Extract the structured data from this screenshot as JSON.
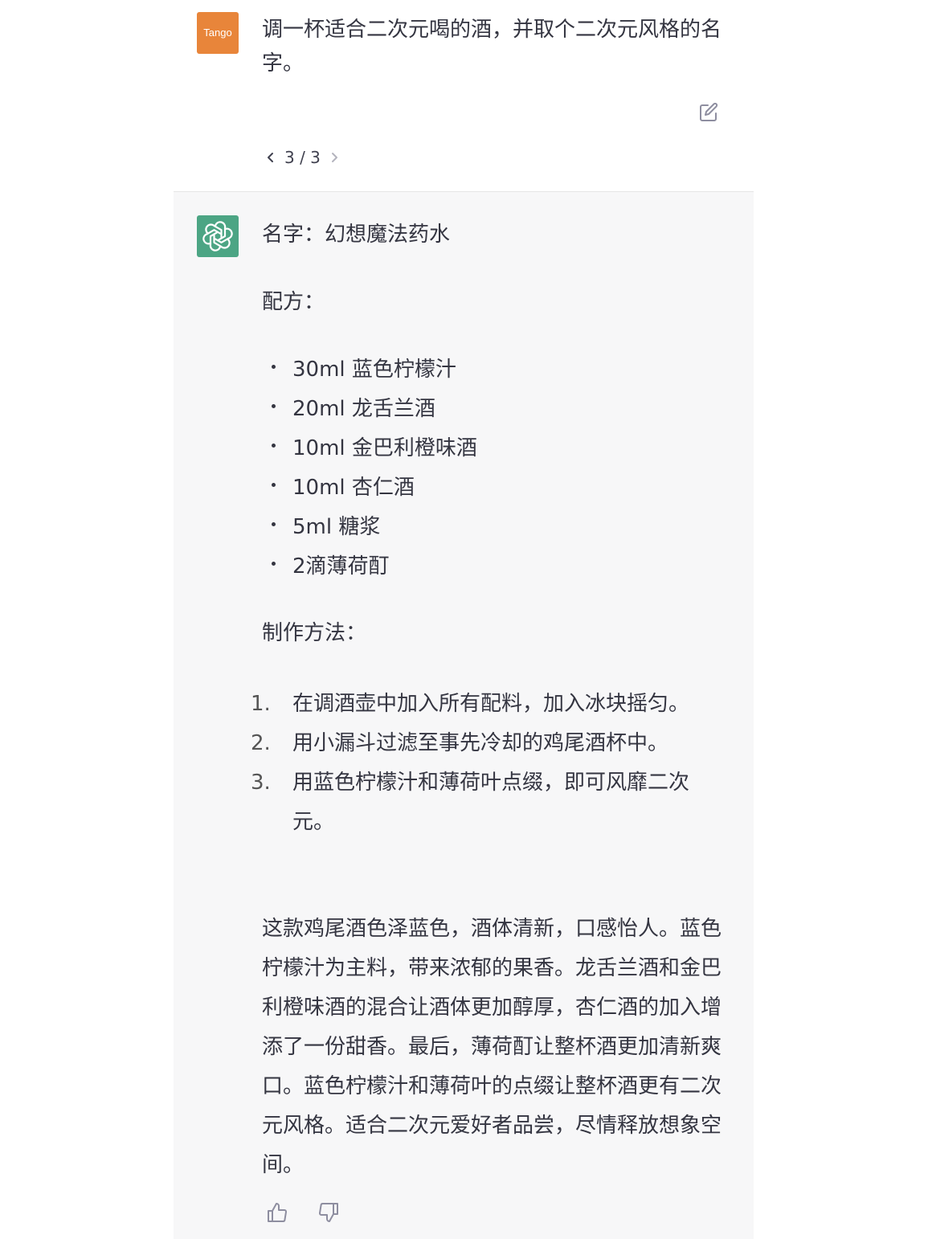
{
  "user_message": {
    "avatar_label": "Tango",
    "text": "调一杯适合二次元喝的酒，并取个二次元风格的名字。",
    "pager": "3 / 3"
  },
  "assistant_message": {
    "title_line": "名字：幻想魔法药水",
    "formula_label": "配方：",
    "ingredients": [
      "30ml 蓝色柠檬汁",
      "20ml 龙舌兰酒",
      "10ml 金巴利橙味酒",
      "10ml 杏仁酒",
      "5ml 糖浆",
      "2滴薄荷酊"
    ],
    "method_label": "制作方法：",
    "steps": [
      {
        "num": "1.",
        "text": "在调酒壶中加入所有配料，加入冰块摇匀。"
      },
      {
        "num": "2.",
        "text": "用小漏斗过滤至事先冷却的鸡尾酒杯中。"
      },
      {
        "num": "3.",
        "text": "用蓝色柠檬汁和薄荷叶点缀，即可风靡二次元。"
      }
    ],
    "description": "这款鸡尾酒色泽蓝色，酒体清新，口感怡人。蓝色柠檬汁为主料，带来浓郁的果香。龙舌兰酒和金巴利橙味酒的混合让酒体更加醇厚，杏仁酒的加入增添了一份甜香。最后，薄荷酊让整杯酒更加清新爽口。蓝色柠檬汁和薄荷叶的点缀让整杯酒更有二次元风格。适合二次元爱好者品尝，尽情释放想象空间。"
  },
  "icons": {
    "edit": "edit-icon",
    "prev": "chevron-left-icon",
    "next": "chevron-right-icon",
    "bot_avatar": "openai-logo-icon",
    "like": "thumbs-up-icon",
    "dislike": "thumbs-down-icon"
  },
  "colors": {
    "user_avatar": "#e8853a",
    "bot_avatar": "#4ca584",
    "assistant_bg": "#f7f7f8",
    "text": "#343541"
  }
}
